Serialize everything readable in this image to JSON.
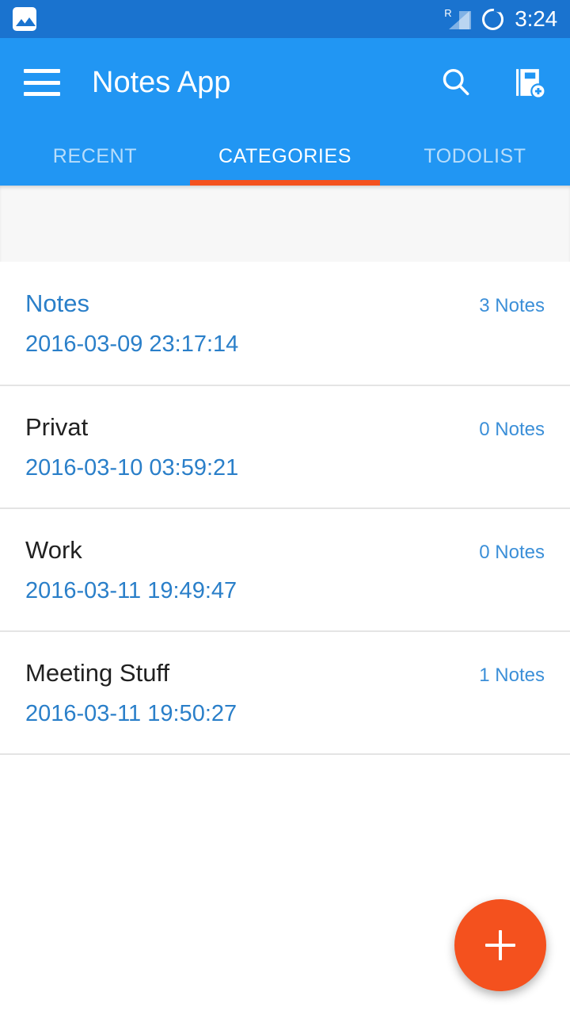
{
  "status_bar": {
    "notification_icon": "photo-icon",
    "roaming_label": "R",
    "signal_icon": "signal-bars-icon",
    "battery_icon": "battery-ring-icon",
    "time": "3:24",
    "background_color": "#1a73cf"
  },
  "app_bar": {
    "menu_icon": "hamburger-menu-icon",
    "title": "Notes App",
    "search_icon": "search-icon",
    "add_notebook_icon": "add-notebook-icon",
    "background_color": "#2196f3"
  },
  "tabs": {
    "active_index": 1,
    "indicator_color": "#f4511e",
    "items": [
      {
        "label": "RECENT"
      },
      {
        "label": "CATEGORIES"
      },
      {
        "label": "TODOLIST"
      }
    ]
  },
  "categories": {
    "items": [
      {
        "title": "Notes",
        "date": "2016-03-09 23:17:14",
        "count": "3 Notes",
        "title_color": "#2a7fc9"
      },
      {
        "title": "Privat",
        "date": "2016-03-10 03:59:21",
        "count": "0 Notes",
        "title_color": "#212121"
      },
      {
        "title": "Work",
        "date": "2016-03-11 19:49:47",
        "count": "0 Notes",
        "title_color": "#212121"
      },
      {
        "title": "Meeting Stuff",
        "date": "2016-03-11 19:50:27",
        "count": "1 Notes",
        "title_color": "#212121"
      }
    ]
  },
  "fab": {
    "icon": "plus-icon",
    "color": "#f4511e"
  }
}
